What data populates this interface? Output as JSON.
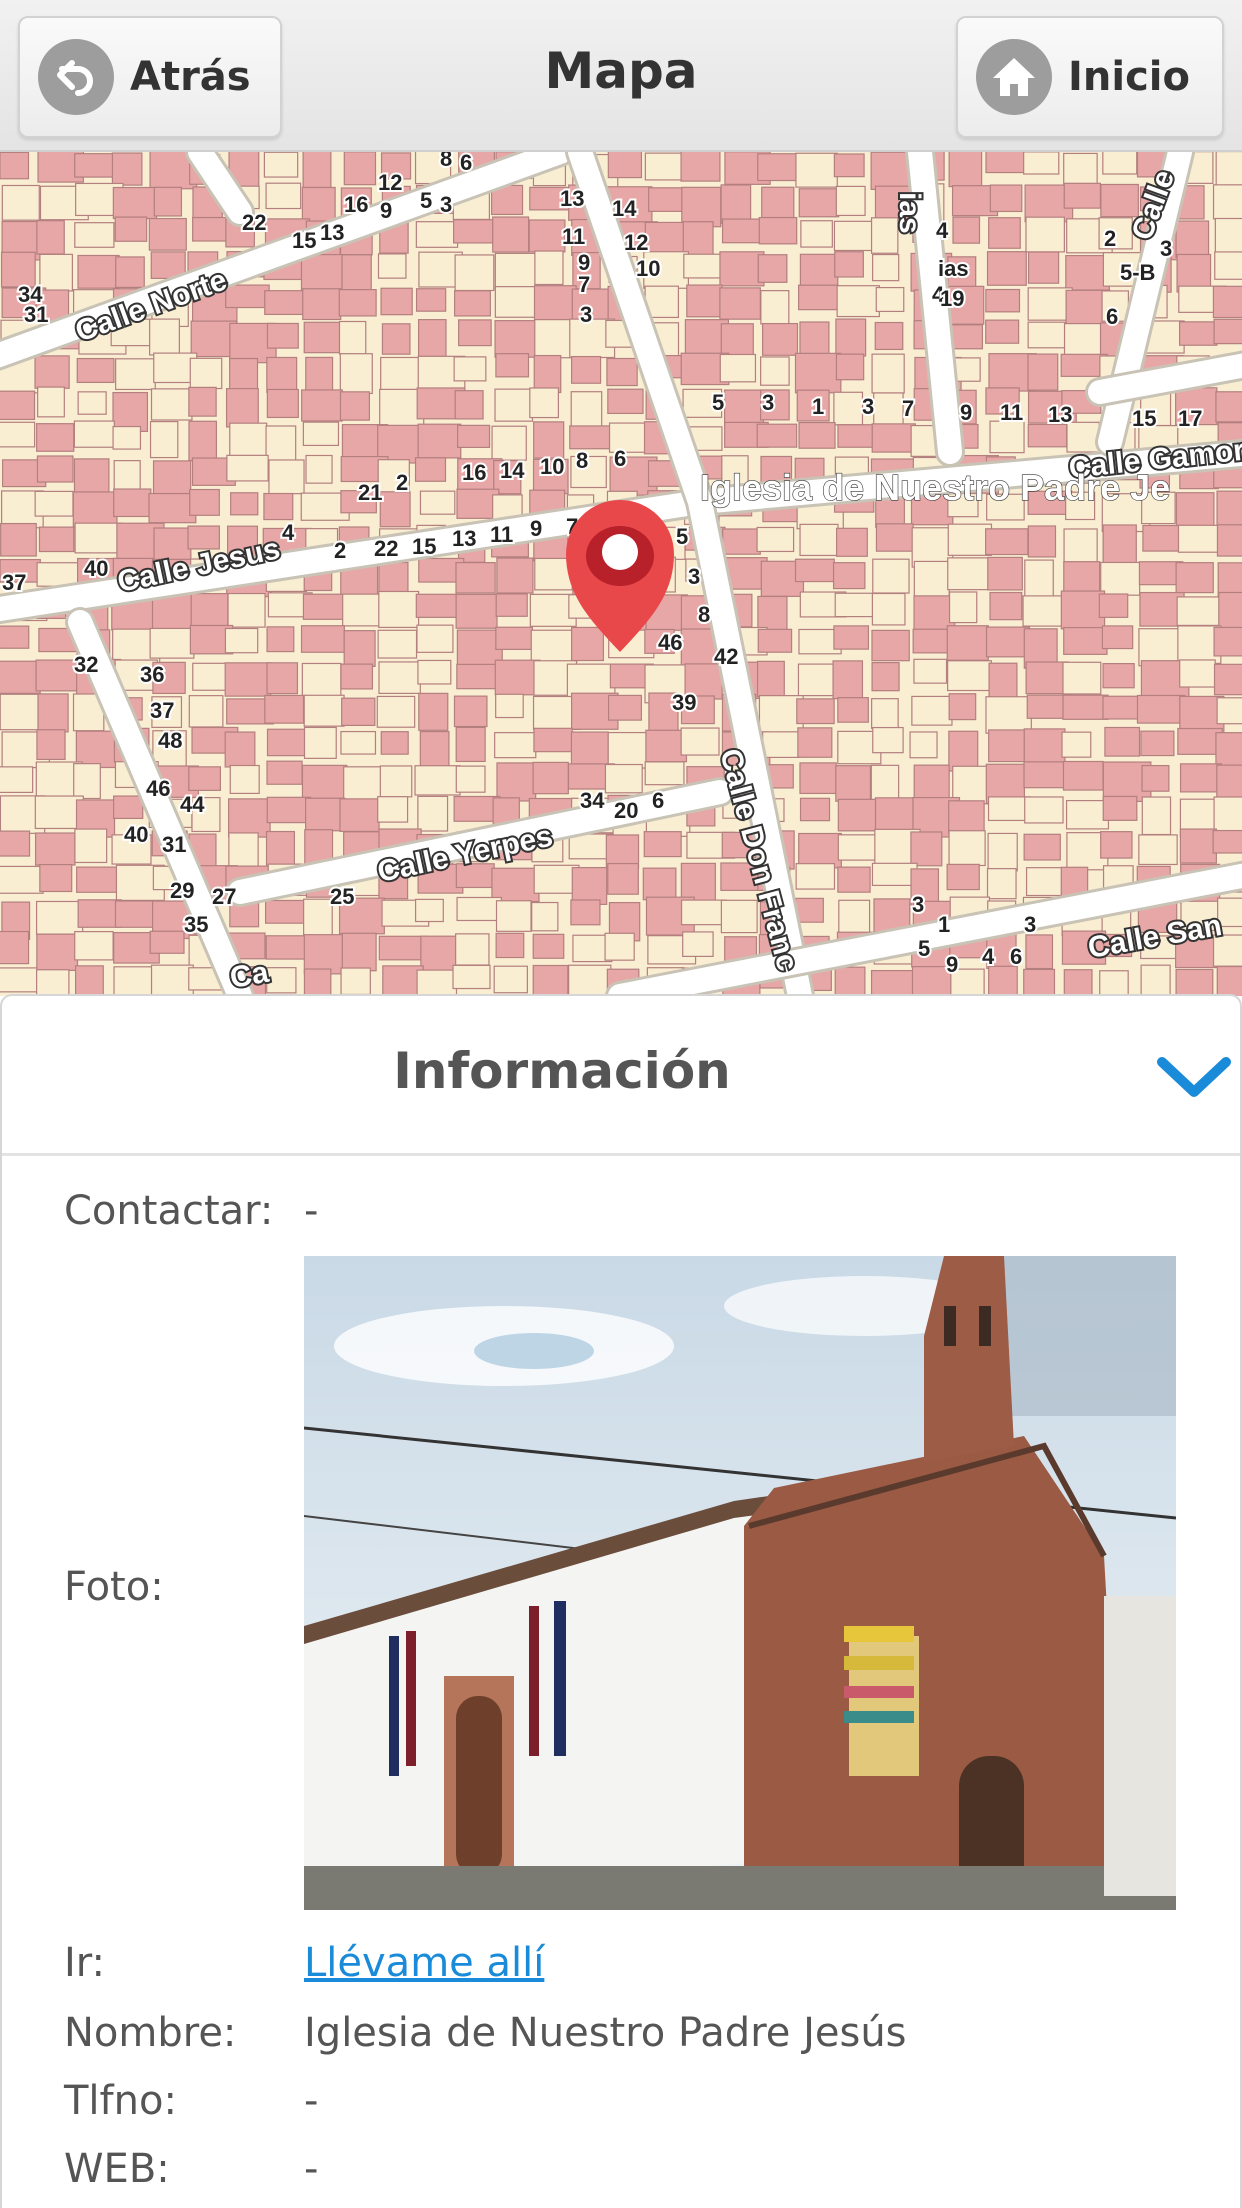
{
  "header": {
    "back_label": "Atrás",
    "title": "Mapa",
    "home_label": "Inicio",
    "back_icon": "back-arrow-icon",
    "home_icon": "home-icon"
  },
  "map": {
    "streets": [
      "Calle Norte",
      "Calle Jesus",
      "Calle Yerpes",
      "Calle Don Franc",
      "Calle Gamor",
      "Calle San",
      "Calle",
      "ias",
      "Ca"
    ],
    "place_label": "Iglesia de Nuestro Padre Je",
    "pin_icon": "map-pin-icon",
    "house_numbers": [
      "8",
      "6",
      "12",
      "16",
      "5",
      "3",
      "9",
      "22",
      "15",
      "13",
      "34",
      "31",
      "13",
      "11",
      "9",
      "7",
      "3",
      "14",
      "12",
      "10",
      "6",
      "4",
      "ias",
      "4",
      "2",
      "3",
      "5-B",
      "6",
      "5",
      "3",
      "1",
      "3",
      "7",
      "9",
      "11",
      "13",
      "15",
      "17",
      "19",
      "21",
      "2",
      "16",
      "14",
      "10",
      "8",
      "6",
      "4",
      "2",
      "22",
      "15",
      "13",
      "11",
      "9",
      "7",
      "5",
      "3",
      "8",
      "46",
      "42",
      "39",
      "40",
      "37",
      "32",
      "36",
      "37",
      "48",
      "46",
      "44",
      "31",
      "40",
      "29",
      "35",
      "27",
      "25",
      "34",
      "20",
      "6",
      "3",
      "1",
      "3",
      "5",
      "9",
      "4",
      "6",
      "8",
      "10"
    ]
  },
  "info": {
    "title": "Información",
    "collapse_icon": "chevron-down-icon",
    "contact_label": "Contactar:",
    "contact_value": "-",
    "photo_label": "Foto:",
    "go_label": "Ir:",
    "go_link": "Llévame allí",
    "name_label": "Nombre:",
    "name_value": "Iglesia de Nuestro Padre Jesús",
    "phone_label": "Tlfno:",
    "phone_value": "-",
    "web_label": "WEB:",
    "web_value": "-"
  },
  "colors": {
    "accent": "#1a8bd8",
    "pin": "#e9484b",
    "building": "#e8a7a7",
    "block": "#f9eed2",
    "road": "#ffffff"
  }
}
